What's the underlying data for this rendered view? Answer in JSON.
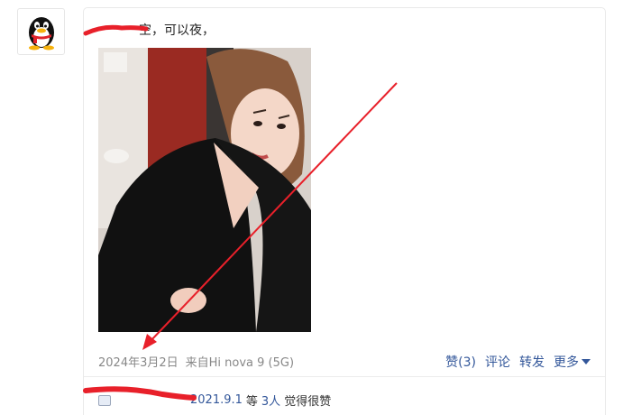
{
  "post": {
    "text": "空，可以夜，",
    "time": "2024年3月2日",
    "source": "来自Hi nova 9 (5G)"
  },
  "actions": {
    "like": "赞(3)",
    "comment": "评论",
    "share": "转发",
    "more": "更多"
  },
  "likes": {
    "date": "2021.9.1",
    "mid": "等",
    "count": "3人",
    "suffix": "觉得很赞"
  },
  "colors": {
    "link": "#33579a",
    "annotation": "#e8202a"
  }
}
